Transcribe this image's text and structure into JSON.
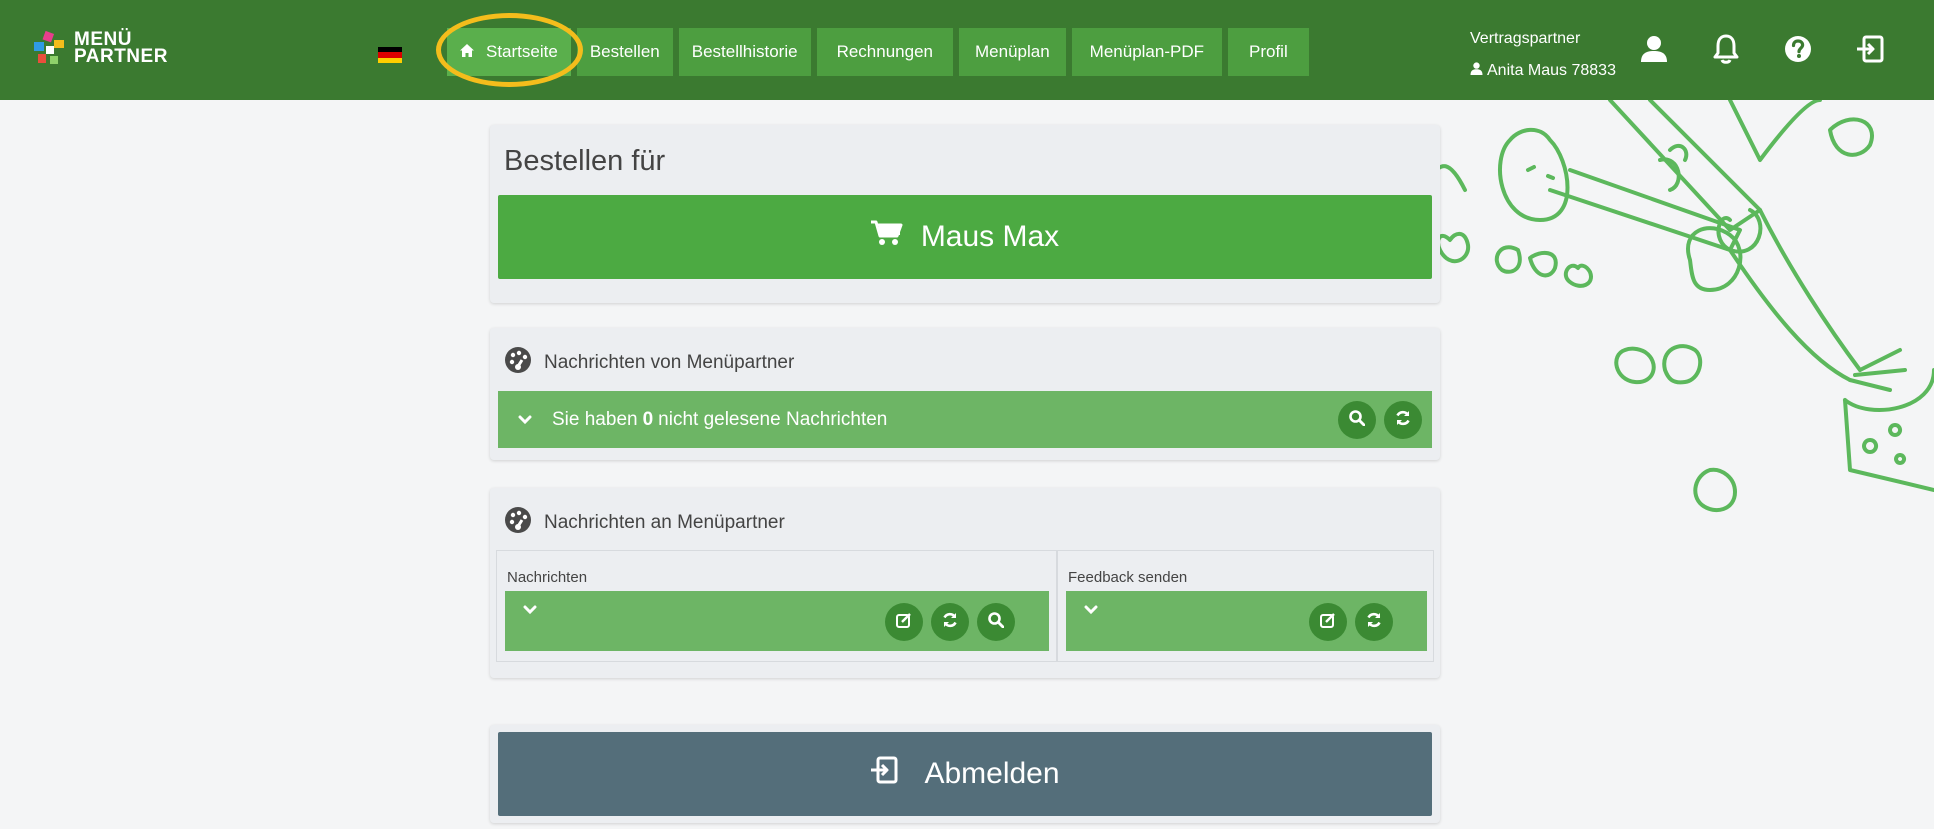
{
  "brand": {
    "line1": "MENÜ",
    "line2": "PARTNER"
  },
  "language_flag": "de-flag",
  "nav": {
    "items": [
      {
        "label": "Startseite",
        "active": true
      },
      {
        "label": "Bestellen"
      },
      {
        "label": "Bestellhistorie"
      },
      {
        "label": "Rechnungen"
      },
      {
        "label": "Menüplan"
      },
      {
        "label": "Menüplan-PDF"
      },
      {
        "label": "Profil"
      }
    ]
  },
  "partner": {
    "role": "Vertragspartner",
    "name": "Anita Maus 78833"
  },
  "header_icons": [
    "user-icon",
    "bell-icon",
    "help-icon",
    "logout-icon"
  ],
  "order": {
    "title": "Bestellen für",
    "button_label": "Maus Max"
  },
  "inbox": {
    "heading": "Nachrichten von Menüpartner",
    "prefix": "Sie haben",
    "count": "0",
    "suffix": "nicht gelesene Nachrichten"
  },
  "outbox": {
    "heading": "Nachrichten an Menüpartner",
    "messages_label": "Nachrichten",
    "feedback_label": "Feedback senden"
  },
  "logout": {
    "label": "Abmelden"
  },
  "colors": {
    "navbar": "#3b7a30",
    "nav_item": "#4d9e40",
    "primary_button": "#4caa42",
    "message_bar": "#6db565",
    "circle_button": "#3b8a33",
    "logout_button": "#546e7a",
    "highlight_ring": "#f4bd1c"
  }
}
